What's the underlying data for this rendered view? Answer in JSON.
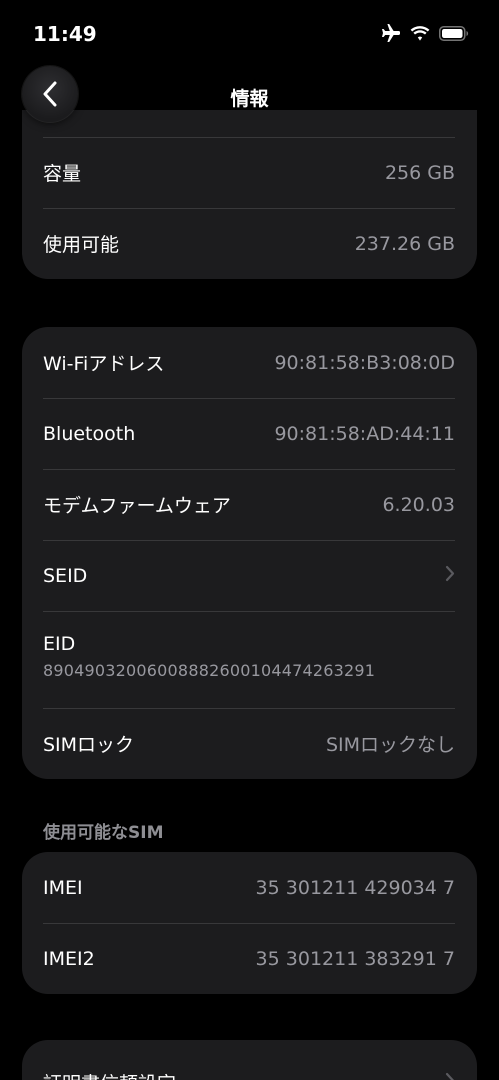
{
  "status_bar": {
    "time": "11:49",
    "icons": [
      "airplane-icon",
      "wifi-icon",
      "battery-icon"
    ]
  },
  "nav": {
    "title": "情報",
    "back_icon": "chevron-left-icon"
  },
  "storage": [
    {
      "label": "容量",
      "value": "256 GB"
    },
    {
      "label": "使用可能",
      "value": "237.26 GB"
    }
  ],
  "network": {
    "wifi": {
      "label": "Wi-Fiアドレス",
      "value": "90:81:58:B3:08:0D"
    },
    "bluetooth": {
      "label": "Bluetooth",
      "value": "90:81:58:AD:44:11"
    },
    "modem": {
      "label": "モデムファームウェア",
      "value": "6.20.03"
    },
    "seid": {
      "label": "SEID"
    },
    "eid": {
      "label": "EID",
      "value": "89049032006008882600104474263291"
    },
    "sim_lock": {
      "label": "SIMロック",
      "value": "SIMロックなし"
    }
  },
  "sim_section": {
    "header": "使用可能なSIM",
    "rows": [
      {
        "label": "IMEI",
        "value": "35 301211 429034 7"
      },
      {
        "label": "IMEI2",
        "value": "35 301211 383291 7"
      }
    ]
  },
  "certificates": {
    "label": "証明書信頼設定"
  },
  "colors": {
    "background": "#000000",
    "card": "#1c1c1e",
    "secondary_text": "#98989f",
    "separator": "#38383a"
  }
}
